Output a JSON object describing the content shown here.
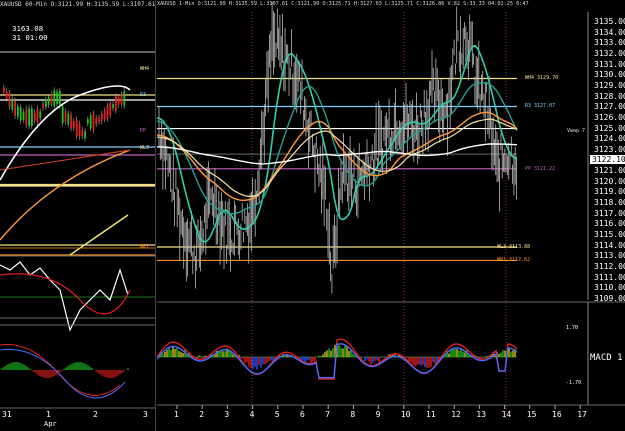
{
  "left_chart": {
    "header": "XAUUSD 60-Min O:3121.99 H:3135.59 L:3107.61 C:3",
    "price_label": "3163.08",
    "date_label": "31 01:00",
    "level_labels": [
      {
        "text": "WH4",
        "color": "#f2e08a",
        "price": 3129.7
      },
      {
        "text": "R3",
        "color": "#7fd0ff",
        "price": 3127.07
      },
      {
        "text": "PP",
        "color": "#c060c0",
        "price": 3121.22
      },
      {
        "text": "WL3",
        "color": "#f2e08a",
        "price": 3113.88
      },
      {
        "text": "WR1",
        "color": "#ff9020",
        "price": 3112.62
      }
    ],
    "x_labels": [
      "31",
      "1",
      "2",
      "3"
    ],
    "month_label": "Apr"
  },
  "right_chart": {
    "header": "XAUUSD 1-Min O:3121.99 H:3135.59 L:3107.61 C:3121.99 O:3125.71 H:3127.03 L:3125.71 C:3126.86 V:82 S:33.33 04:02:25 0:47",
    "price_ticks": [
      "3135.00",
      "3134.00",
      "3133.00",
      "3132.00",
      "3131.00",
      "3130.00",
      "3129.00",
      "3128.00",
      "3127.00",
      "3126.00",
      "3125.00",
      "3124.00",
      "3123.00",
      "3122.00",
      "3121.00",
      "3120.00",
      "3119.00",
      "3118.00",
      "3117.00",
      "3116.00",
      "3115.00",
      "3114.00",
      "3113.00",
      "3112.00",
      "3111.00",
      "3110.00",
      "3109.00"
    ],
    "last_price": "3122.10",
    "vwap_label": "Vwap 7",
    "level_labels": [
      {
        "text": "WH4 3129.70",
        "color": "#f2e08a",
        "price": 3129.7
      },
      {
        "text": "R3 3127.07",
        "color": "#7fd0ff",
        "price": 3127.07
      },
      {
        "text": "PP 3121.22",
        "color": "#c060c0",
        "price": 3121.22
      },
      {
        "text": "WL3 3113.88",
        "color": "#f2e08a",
        "price": 3113.88
      },
      {
        "text": "WR1 3112.62",
        "color": "#ff9020",
        "price": 3112.62
      }
    ],
    "macd_label": "MACD 1",
    "macd_ticks": [
      "1.70",
      "-1.70"
    ],
    "x_labels": [
      "1",
      "2",
      "3",
      "4",
      "5",
      "6",
      "7",
      "8",
      "9",
      "10",
      "11",
      "12",
      "13",
      "14",
      "15",
      "16",
      "17"
    ]
  },
  "colors": {
    "background": "#000000",
    "white_line": "#ffffff",
    "teal_ma": "#2ecfae",
    "orange_ma": "#ff9a3a",
    "yellow_ma": "#f2e08a",
    "level_cyan": "#7fd0ff",
    "level_magenta": "#c060c0",
    "macd_up": "#20c020",
    "macd_down": "#e02020",
    "macd_blue": "#4a6cff"
  }
}
